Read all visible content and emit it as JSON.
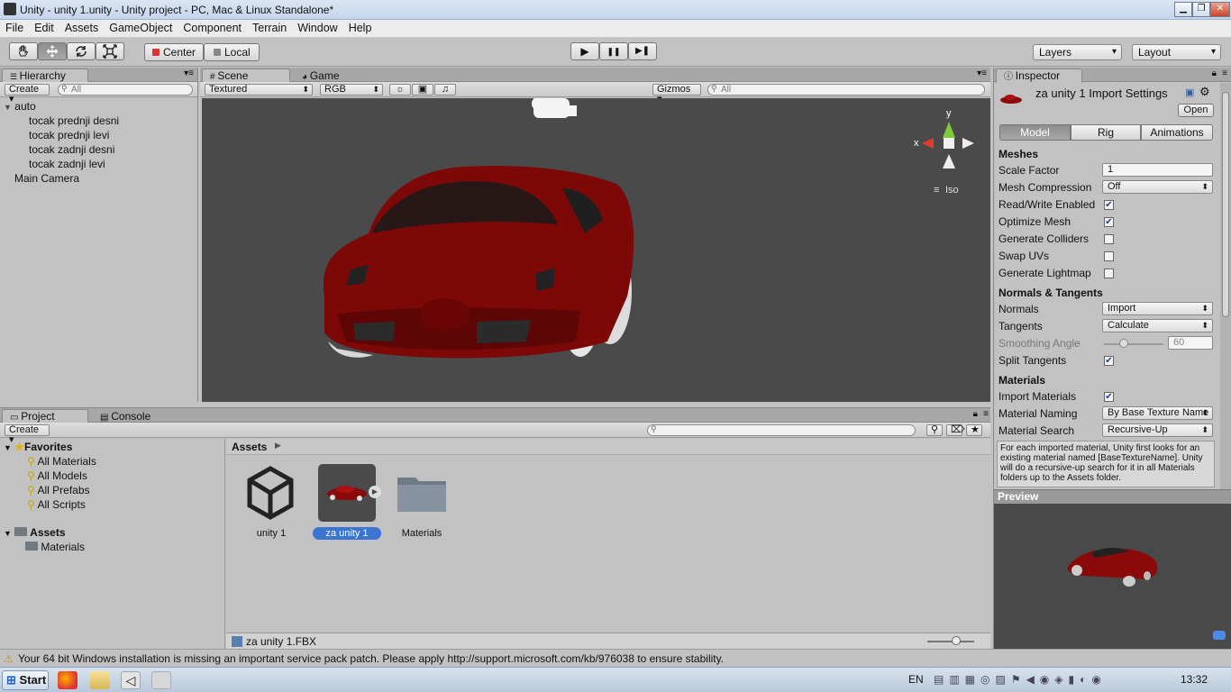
{
  "window": {
    "title": "Unity - unity 1.unity - Unity project - PC, Mac & Linux Standalone*",
    "controls": {
      "minimize": "▁",
      "maximize": "❐",
      "close": "✕"
    }
  },
  "menu": [
    "File",
    "Edit",
    "Assets",
    "GameObject",
    "Component",
    "Terrain",
    "Window",
    "Help"
  ],
  "toolbar": {
    "pivot": "Center",
    "space": "Local",
    "layers": "Layers",
    "layout": "Layout",
    "play": "▶",
    "pause": "❚❚",
    "step": "▶❚"
  },
  "hierarchy": {
    "tab": "Hierarchy",
    "create": "Create",
    "search_placeholder": "All",
    "items": [
      {
        "label": "auto",
        "expanded": "▼"
      },
      {
        "label": "tocak prednji desni"
      },
      {
        "label": "tocak prednji levi"
      },
      {
        "label": "tocak zadnji desni"
      },
      {
        "label": "tocak zadnji levi"
      },
      {
        "label": "Main Camera"
      }
    ]
  },
  "scene": {
    "tab_scene": "Scene",
    "tab_game": "Game",
    "draw_mode": "Textured",
    "render_mode": "RGB",
    "gizmos": "Gizmos",
    "search_placeholder": "All",
    "gizmo": {
      "y": "y",
      "x": "x",
      "persp": "Iso"
    },
    "car_color": "#8a0a0a"
  },
  "project": {
    "tab_project": "Project",
    "tab_console": "Console",
    "create": "Create",
    "favorites_header": "Favorites",
    "favorites": [
      "All Materials",
      "All Models",
      "All Prefabs",
      "All Scripts"
    ],
    "assets_header": "Assets",
    "asset_folders": [
      "Materials"
    ],
    "breadcrumb": "Assets",
    "assets": [
      {
        "label": "unity 1"
      },
      {
        "label": "za unity 1"
      },
      {
        "label": "Materials"
      }
    ],
    "footer_file": "za unity 1.FBX"
  },
  "inspector": {
    "tab": "Inspector",
    "title": "za unity 1 Import Settings",
    "open": "Open",
    "tabs": [
      "Model",
      "Rig",
      "Animations"
    ],
    "meshes_header": "Meshes",
    "scale_factor_label": "Scale Factor",
    "scale_factor_value": "1",
    "mesh_compression_label": "Mesh Compression",
    "mesh_compression_value": "Off",
    "read_write_label": "Read/Write Enabled",
    "optimize_mesh_label": "Optimize Mesh",
    "generate_colliders_label": "Generate Colliders",
    "swap_uvs_label": "Swap UVs",
    "generate_lightmap_label": "Generate Lightmap",
    "normals_header": "Normals & Tangents",
    "normals_label": "Normals",
    "normals_value": "Import",
    "tangents_label": "Tangents",
    "tangents_value": "Calculate",
    "smoothing_label": "Smoothing Angle",
    "smoothing_value": "60",
    "split_tangents_label": "Split Tangents",
    "materials_header": "Materials",
    "import_materials_label": "Import Materials",
    "material_naming_label": "Material Naming",
    "material_naming_value": "By Base Texture Name",
    "material_search_label": "Material Search",
    "material_search_value": "Recursive-Up",
    "help_text": "For each imported material, Unity first looks for an existing material named [BaseTextureName]. Unity will do a recursive-up search for it in all Materials folders up to the Assets folder.",
    "check": "✔",
    "preview_header": "Preview"
  },
  "status": {
    "message": "Your 64 bit Windows installation is missing an important service pack patch. Please apply http://support.microsoft.com/kb/976038 to ensure stability."
  },
  "taskbar": {
    "start": "Start",
    "language": "EN",
    "clock": "13:32"
  }
}
